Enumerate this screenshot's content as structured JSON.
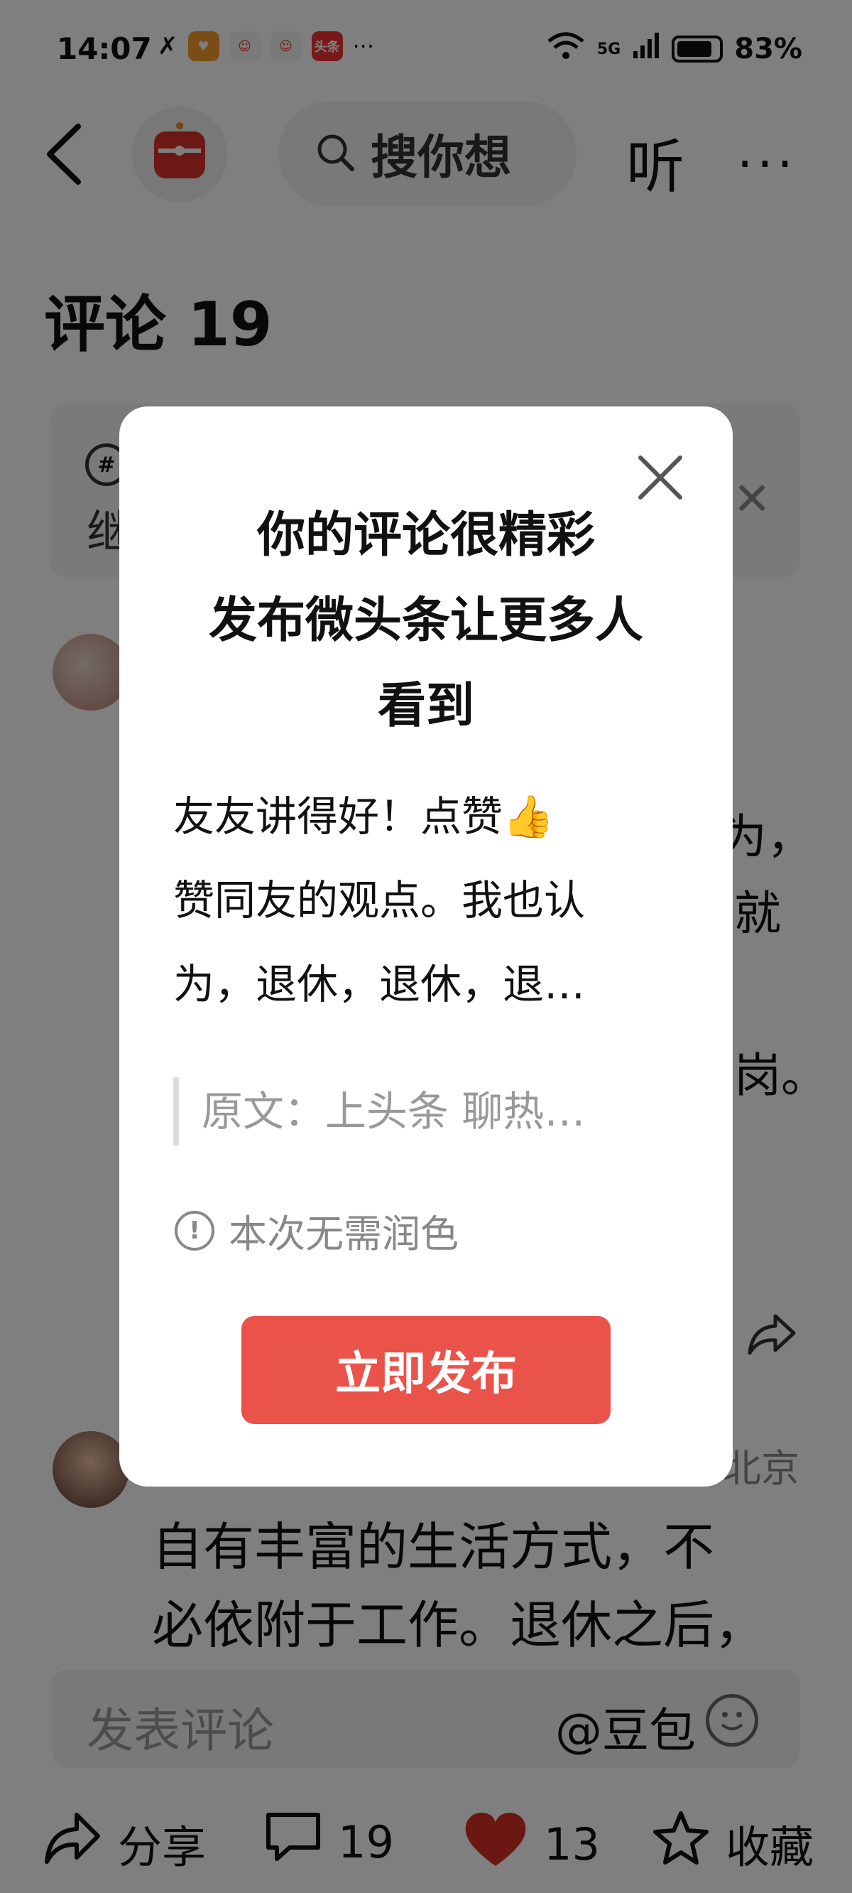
{
  "status_bar": {
    "time": "14:07",
    "app_badge_toutiao": "头条",
    "overflow": "···",
    "network": "5G",
    "battery": "83%"
  },
  "header": {
    "search_placeholder": "搜你想",
    "listen_label": "听",
    "more_label": "···"
  },
  "comments": {
    "title": "评论 19",
    "topic_icon": "#",
    "topic_text": "继",
    "comment1_fragments": [
      "为，",
      "就",
      "岗。"
    ],
    "comment2_location": "北京",
    "comment2_lines": [
      "自有丰富的生活方式，不",
      "必依附于工作。退休之后，"
    ]
  },
  "comment_input": {
    "placeholder": "发表评论",
    "doubao_label": "@豆包"
  },
  "bottom_bar": {
    "share_label": "分享",
    "comment_count": "19",
    "like_count": "13",
    "collect_label": "收藏"
  },
  "modal": {
    "title_lines": [
      "你的评论很精彩",
      "发布微头条让更多人",
      "看到"
    ],
    "body_line1": "友友讲得好！点赞",
    "body_line2": "赞同友的观点。我也认",
    "body_line3": "为，退休，退休，退…",
    "quote": "原文：上头条 聊热…",
    "notice": "本次无需润色",
    "publish_button": "立即发布"
  },
  "colors": {
    "accent": "#e9534a",
    "like_red": "#d93025",
    "overlay": "rgba(0,0,0,0.5)"
  }
}
